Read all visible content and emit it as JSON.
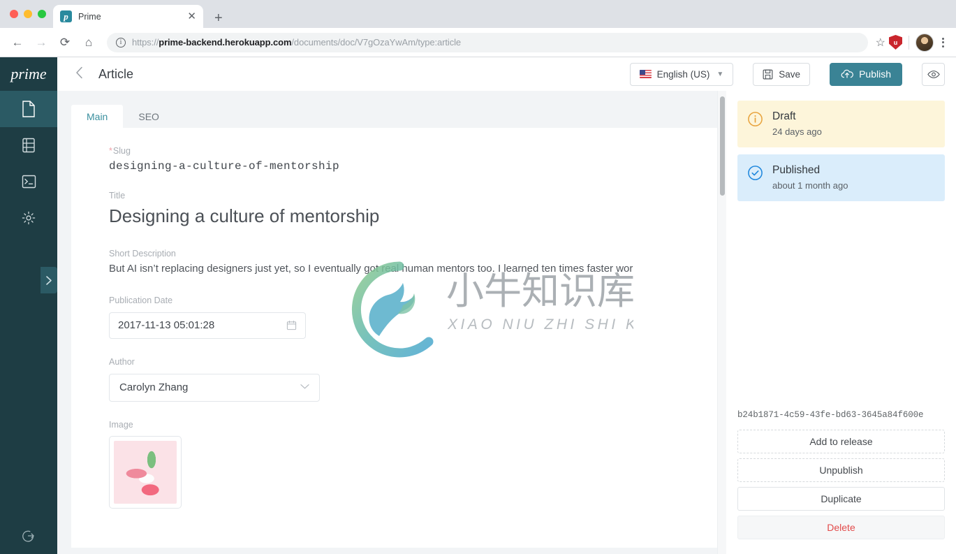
{
  "browser": {
    "tab": {
      "title": "Prime",
      "favicon_letter": "p",
      "close_icon": "close-icon"
    },
    "newtab_label": "+",
    "url_protocol": "https://",
    "url_host": "prime-backend.herokuapp.com",
    "url_path": "/documents/doc/V7gOzaYwAm/type:article",
    "back_icon": "←",
    "forward_icon": "→",
    "reload_icon": "⟳",
    "home_icon": "⌂",
    "star_icon": "☆",
    "extension_label": "u",
    "accent": "#2a8a9e"
  },
  "sidebar": {
    "logo": "prime",
    "items": [
      {
        "name": "documents",
        "icon": "document-icon",
        "active": true
      },
      {
        "name": "collections",
        "icon": "database-icon",
        "active": false
      },
      {
        "name": "console",
        "icon": "terminal-icon",
        "active": false
      },
      {
        "name": "settings",
        "icon": "gear-icon",
        "active": false
      }
    ],
    "expander_icon": "chevron-right-icon",
    "logout_icon": "logout-icon"
  },
  "header": {
    "back_icon": "chevron-left-icon",
    "title": "Article",
    "language": "English (US)",
    "language_flag": "us-flag-icon",
    "save_label": "Save",
    "save_icon": "floppy-disk-icon",
    "publish_label": "Publish",
    "publish_icon": "cloud-upload-icon",
    "publish_color": "#3a8395",
    "preview_icon": "eye-icon"
  },
  "editor": {
    "tabs": [
      {
        "label": "Main",
        "active": true
      },
      {
        "label": "SEO",
        "active": false
      }
    ],
    "fields": {
      "slug": {
        "label": "Slug",
        "required": true,
        "value": "designing-a-culture-of-mentorship"
      },
      "title": {
        "label": "Title",
        "value": "Designing a culture of mentorship"
      },
      "short_description": {
        "label": "Short Description",
        "value": "But AI isn’t replacing designers just yet, so I eventually got real human mentors too. I learned ten times faster wor"
      },
      "publication_date": {
        "label": "Publication Date",
        "value": "2017-11-13 05:01:28",
        "icon": "calendar-icon"
      },
      "author": {
        "label": "Author",
        "value": "Carolyn Zhang",
        "icon": "chevron-down-icon"
      },
      "image": {
        "label": "Image"
      }
    }
  },
  "right_panel": {
    "statuses": [
      {
        "name": "draft",
        "title": "Draft",
        "time": "24 days ago",
        "icon": "info-circle-icon",
        "bg": "#fdf5da",
        "icon_color": "#e8a33d"
      },
      {
        "name": "published",
        "title": "Published",
        "time": "about 1 month ago",
        "icon": "check-circle-icon",
        "bg": "#daedfb",
        "icon_color": "#1e87dd"
      }
    ],
    "document_id": "b24b1871-4c59-43fe-bd63-3645a84f600e",
    "actions": [
      {
        "label": "Add to release",
        "style": "dashed"
      },
      {
        "label": "Unpublish",
        "style": "dashed"
      },
      {
        "label": "Duplicate",
        "style": "solid"
      },
      {
        "label": "Delete",
        "style": "danger",
        "color": "#e24b4b"
      }
    ]
  },
  "watermark": {
    "chinese": "小牛知识库",
    "pinyin": "XIAO NIU ZHI SHI KU"
  }
}
